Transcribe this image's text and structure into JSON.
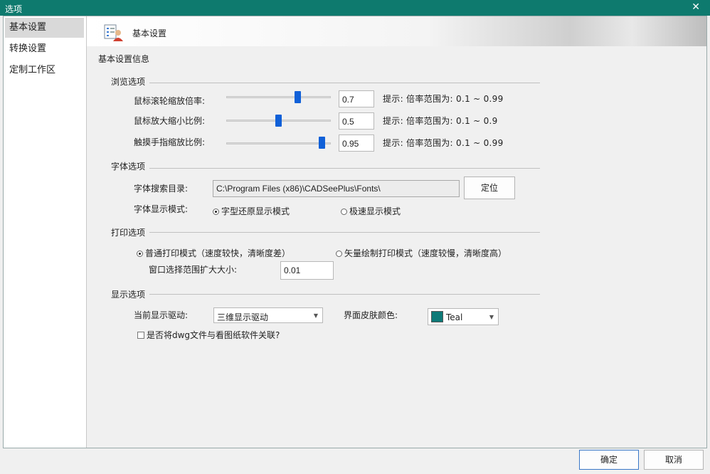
{
  "window": {
    "title": "选项"
  },
  "sidebar": {
    "items": [
      {
        "label": "基本设置"
      },
      {
        "label": "转换设置"
      },
      {
        "label": "定制工作区"
      }
    ]
  },
  "header": {
    "title": "基本设置"
  },
  "section_info": "基本设置信息",
  "browse": {
    "title": "浏览选项",
    "rows": [
      {
        "label": "鼠标滚轮缩放倍率:",
        "value": "0.7",
        "level": 0.7,
        "hint": "提示: 倍率范围为: 0.1 ~ 0.99"
      },
      {
        "label": "鼠标放大缩小比例:",
        "value": "0.5",
        "level": 0.5,
        "hint": "提示: 倍率范围为: 0.1 ~ 0.9"
      },
      {
        "label": "触摸手指缩放比例:",
        "value": "0.95",
        "level": 0.95,
        "hint": "提示: 倍率范围为: 0.1 ~ 0.99"
      }
    ]
  },
  "font": {
    "title": "字体选项",
    "dir_label": "字体搜索目录:",
    "dir_value": "C:\\Program Files (x86)\\CADSeePlus\\Fonts\\",
    "locate_label": "定位",
    "mode_label": "字体显示模式:",
    "mode_options": [
      "字型还原显示模式",
      "极速显示模式"
    ],
    "mode_selected": 0
  },
  "print": {
    "title": "打印选项",
    "mode_options": [
      "普通打印模式（速度较快，清晰度差）",
      "矢量绘制打印模式（速度较慢，清晰度高）"
    ],
    "mode_selected": 0,
    "window_label": "窗口选择范围扩大大小:",
    "window_value": "0.01"
  },
  "display": {
    "title": "显示选项",
    "driver_label": "当前显示驱动:",
    "driver_value": "三维显示驱动",
    "skin_label": "界面皮肤颜色:",
    "skin_value": "Teal",
    "skin_color": "#0e7a78",
    "assoc_label": "是否将dwg文件与看图纸软件关联?",
    "assoc_checked": false
  },
  "footer": {
    "ok_label": "确定",
    "cancel_label": "取消"
  },
  "colors": {
    "titlebar": "#0e7a6e",
    "slider_thumb": "#1060d8"
  }
}
